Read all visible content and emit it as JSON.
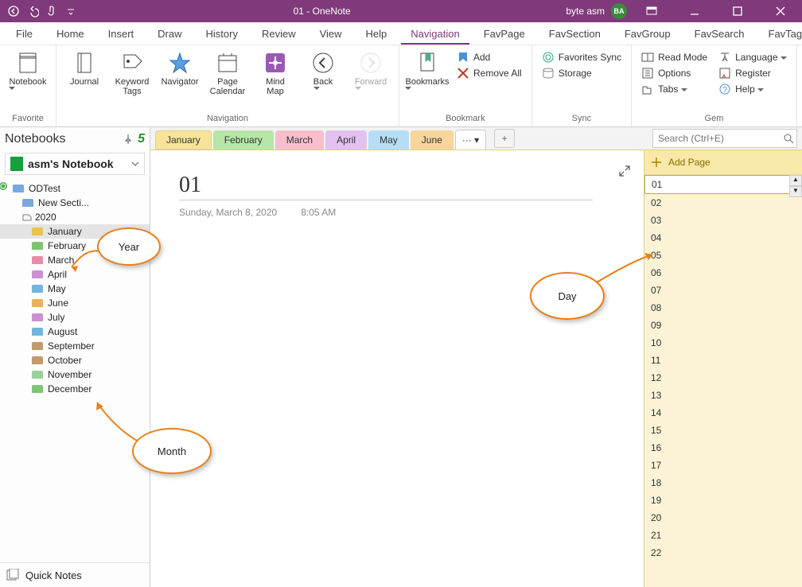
{
  "title": "01  -  OneNote",
  "user": {
    "name": "byte asm",
    "initials": "BA"
  },
  "menuTabs": [
    "File",
    "Home",
    "Insert",
    "Draw",
    "History",
    "Review",
    "View",
    "Help",
    "Navigation",
    "FavPage",
    "FavSection",
    "FavGroup",
    "FavSearch",
    "FavTag"
  ],
  "menuActive": "Navigation",
  "ribbon": {
    "groups": [
      {
        "label": "Favorite",
        "big": [
          {
            "name": "notebook",
            "label": "Notebook",
            "drop": true
          }
        ]
      },
      {
        "label": "Navigation",
        "big": [
          {
            "name": "journal",
            "label": "Journal"
          },
          {
            "name": "keyword-tags",
            "label": "Keyword\nTags"
          },
          {
            "name": "navigator",
            "label": "Navigator"
          },
          {
            "name": "page-calendar",
            "label": "Page\nCalendar"
          },
          {
            "name": "mind-map",
            "label": "Mind\nMap"
          },
          {
            "name": "back",
            "label": "Back",
            "drop": true
          },
          {
            "name": "forward",
            "label": "Forward",
            "drop": true,
            "disabled": true
          }
        ]
      },
      {
        "label": "Bookmark",
        "big": [
          {
            "name": "bookmarks",
            "label": "Bookmarks",
            "drop": true
          }
        ],
        "small": [
          {
            "name": "add",
            "label": "Add"
          },
          {
            "name": "remove-all",
            "label": "Remove All"
          }
        ]
      },
      {
        "label": "Sync",
        "small": [
          {
            "name": "favorites-sync",
            "label": "Favorites Sync"
          },
          {
            "name": "storage",
            "label": "Storage"
          }
        ]
      },
      {
        "label": "Gem",
        "small2": [
          [
            {
              "name": "read-mode",
              "label": "Read Mode"
            },
            {
              "name": "options",
              "label": "Options"
            },
            {
              "name": "tabs",
              "label": "Tabs",
              "drop": true
            }
          ],
          [
            {
              "name": "language",
              "label": "Language",
              "drop": true
            },
            {
              "name": "register",
              "label": "Register"
            },
            {
              "name": "help",
              "label": "Help",
              "drop": true
            }
          ]
        ]
      }
    ]
  },
  "notebooksHeader": "Notebooks",
  "currentNotebook": "asm's Notebook",
  "tree": {
    "section": "ODTest",
    "newSection": "New Secti...",
    "year": "2020",
    "months": [
      "January",
      "February",
      "March",
      "April",
      "May",
      "June",
      "July",
      "August",
      "September",
      "October",
      "November",
      "December"
    ],
    "monthColors": [
      "#E9C64B",
      "#7CC66F",
      "#E98BA6",
      "#C991D1",
      "#6FB7E0",
      "#EBB256",
      "#C991D1",
      "#6FB7E0",
      "#C29A6B",
      "#C29A6B",
      "#9AD19A",
      "#7CC66F"
    ],
    "selected": "January"
  },
  "quickNotes": "Quick Notes",
  "sectionTabs": [
    {
      "label": "January",
      "color": "#F7E49A",
      "active": true
    },
    {
      "label": "February",
      "color": "#B7E6A7"
    },
    {
      "label": "March",
      "color": "#F6BFCB"
    },
    {
      "label": "April",
      "color": "#E3C1F0"
    },
    {
      "label": "May",
      "color": "#B6DDF5"
    },
    {
      "label": "June",
      "color": "#F7D59B"
    }
  ],
  "moreTabs": "···",
  "searchPlaceholder": "Search (Ctrl+E)",
  "page": {
    "title": "01",
    "date": "Sunday, March 8, 2020",
    "time": "8:05 AM"
  },
  "addPage": "Add Page",
  "dayPages": [
    "01",
    "02",
    "03",
    "04",
    "05",
    "06",
    "07",
    "08",
    "09",
    "10",
    "11",
    "12",
    "13",
    "14",
    "15",
    "16",
    "17",
    "18",
    "19",
    "20",
    "21",
    "22"
  ],
  "callouts": {
    "year": "Year",
    "month": "Month",
    "day": "Day"
  }
}
